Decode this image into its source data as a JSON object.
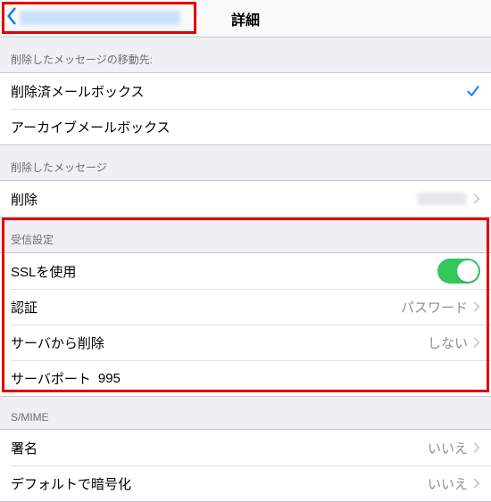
{
  "header": {
    "title": "詳細"
  },
  "sections": {
    "deletedMove": {
      "header": "削除したメッセージの移動先:",
      "deletedMailbox": "削除済メールボックス",
      "archiveMailbox": "アーカイブメールボックス"
    },
    "deletedMsg": {
      "header": "削除したメッセージ",
      "delete": "削除"
    },
    "incoming": {
      "header": "受信設定",
      "ssl": "SSLを使用",
      "auth": "認証",
      "authValue": "パスワード",
      "removeFromServer": "サーバから削除",
      "removeValue": "しない",
      "port": "サーバポート",
      "portValue": "995"
    },
    "smime": {
      "header": "S/MIME",
      "signing": "署名",
      "signingValue": "いいえ",
      "encrypt": "デフォルトで暗号化",
      "encryptValue": "いいえ"
    }
  }
}
